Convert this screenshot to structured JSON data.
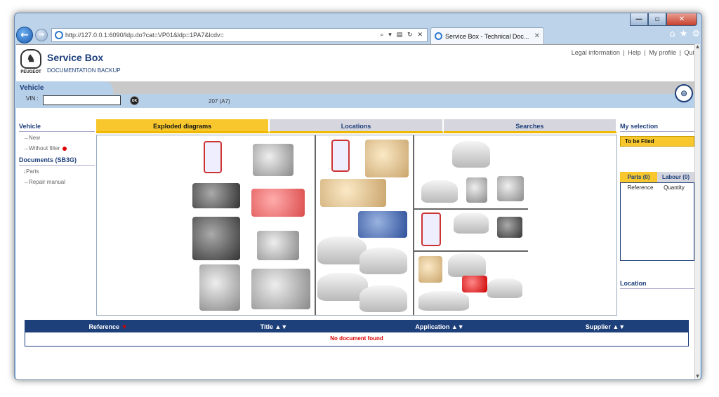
{
  "browser": {
    "url": "http://127.0.0.1:6090/ldp.do?cat=VP01&ldp=1PA7&lcdv=",
    "url_tools": "⌕ ▾ ▤ ↻ ✕",
    "tab_title": "Service Box - Technical Doc...",
    "tab_close": "✕",
    "win_min": "—",
    "win_max": "▫",
    "win_close": "✕",
    "right_icons": [
      "⌂",
      "★",
      "⚙"
    ]
  },
  "header": {
    "logo_letter": "♞",
    "brand": "PEUGEOT",
    "title": "Service Box",
    "subtitle": "DOCUMENTATION BACKUP",
    "links": [
      "Legal information",
      "|",
      "Help",
      "|",
      "My profile",
      "|",
      "Quit"
    ]
  },
  "vehicle": {
    "tab_label": "Vehicle",
    "vin_label": "VIN :",
    "vin_value": "",
    "ok_label": "OK",
    "model": "207 (A7)",
    "basket_icon": "⊜"
  },
  "left_panel": {
    "vehicle_heading": "Vehicle",
    "items": [
      "New",
      "Without filter"
    ],
    "documents_heading": "Documents (SB3G)",
    "doc_items": [
      "Parts",
      "Repair manual"
    ]
  },
  "content_tabs": [
    "Exploded diagrams",
    "Locations",
    "Searches"
  ],
  "right_panel": {
    "my_selection": "My selection",
    "to_be_filed": "To be Filed",
    "parts_tab": "Parts (0)",
    "labour_tab": "Labour (0)",
    "col_reference": "Reference",
    "col_quantity": "Quantity",
    "location": "Location"
  },
  "results": {
    "columns": [
      "Reference",
      "Title",
      "Application",
      "Supplier"
    ],
    "sort_icons": [
      "▼",
      "▲▼",
      "▲▼",
      "▲▼"
    ],
    "empty_message": "No document found"
  },
  "accent_colors": {
    "yellow": "#f7c72d",
    "navy": "#1d3f7a",
    "red": "#dd0000"
  }
}
